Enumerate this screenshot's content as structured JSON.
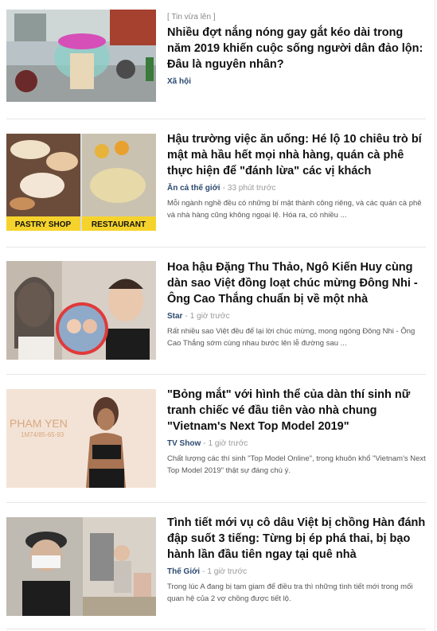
{
  "articles": [
    {
      "kicker": "[ Tin vừa lên ]",
      "title": "Nhiều đợt nắng nóng gay gắt kéo dài trong năm 2019 khiến cuộc sống người dân đảo lộn: Đâu là nguyên nhân?",
      "category": "Xã hội",
      "time": "",
      "sapo": "",
      "image": "street-scooter-photo"
    },
    {
      "kicker": "",
      "title": "Hậu trường việc ăn uống: Hé lộ 10 chiêu trò bí mật mà hầu hết mọi nhà hàng, quán cà phê thực hiện để \"đánh lừa\" các vị khách",
      "category": "Ăn cả thế giới",
      "time": "33 phút trước",
      "sapo": "Mỗi ngành nghề đều có những bí mật thành công riêng, và các quán cà phê và nhà hàng cũng không ngoại lệ. Hóa ra, có nhiều ...",
      "image": "pastry-restaurant-photo",
      "image_labels": [
        "PASTRY SHOP",
        "RESTAURANT"
      ]
    },
    {
      "kicker": "",
      "title": "Hoa hậu Đặng Thu Thảo, Ngô Kiến Huy cùng dàn sao Việt đồng loạt chúc mừng Đông Nhi - Ông Cao Thắng chuẩn bị về một nhà",
      "category": "Star",
      "time": "1 giờ trước",
      "sapo": "Rất nhiều sao Việt đều để lại lời chúc mừng, mong ngóng Đông Nhi - Ông Cao Thắng sớm cùng nhau bước lên lễ đường sau ...",
      "image": "celebrities-photo"
    },
    {
      "kicker": "",
      "title": "\"Bỏng mắt\" với hình thể của dàn thí sinh nữ tranh chiếc vé đầu tiên vào nhà chung \"Vietnam's Next Top Model 2019\"",
      "category": "TV Show",
      "time": "1 giờ trước",
      "sapo": "Chất lượng các thí sinh \"Top Model Online\", trong khuôn khổ \"Vietnam's Next Top Model 2019\" thật sự đáng chú ý.",
      "image": "model-photo",
      "image_labels": [
        "PHAM YEN",
        "1M74/85-65-93"
      ]
    },
    {
      "kicker": "",
      "title": "Tình tiết mới vụ cô dâu Việt bị chồng Hàn đánh đập suốt 3 tiếng: Từng bị ép phá thai, bị bạo hành lần đầu tiên ngay tại quê nhà",
      "category": "Thế Giới",
      "time": "1 giờ trước",
      "sapo": "Trong lúc A đang bị tạm giam để điều tra thì những tình tiết mới trong mối quan hệ của 2 vợ chồng được tiết lộ.",
      "image": "news-collage-photo"
    }
  ]
}
